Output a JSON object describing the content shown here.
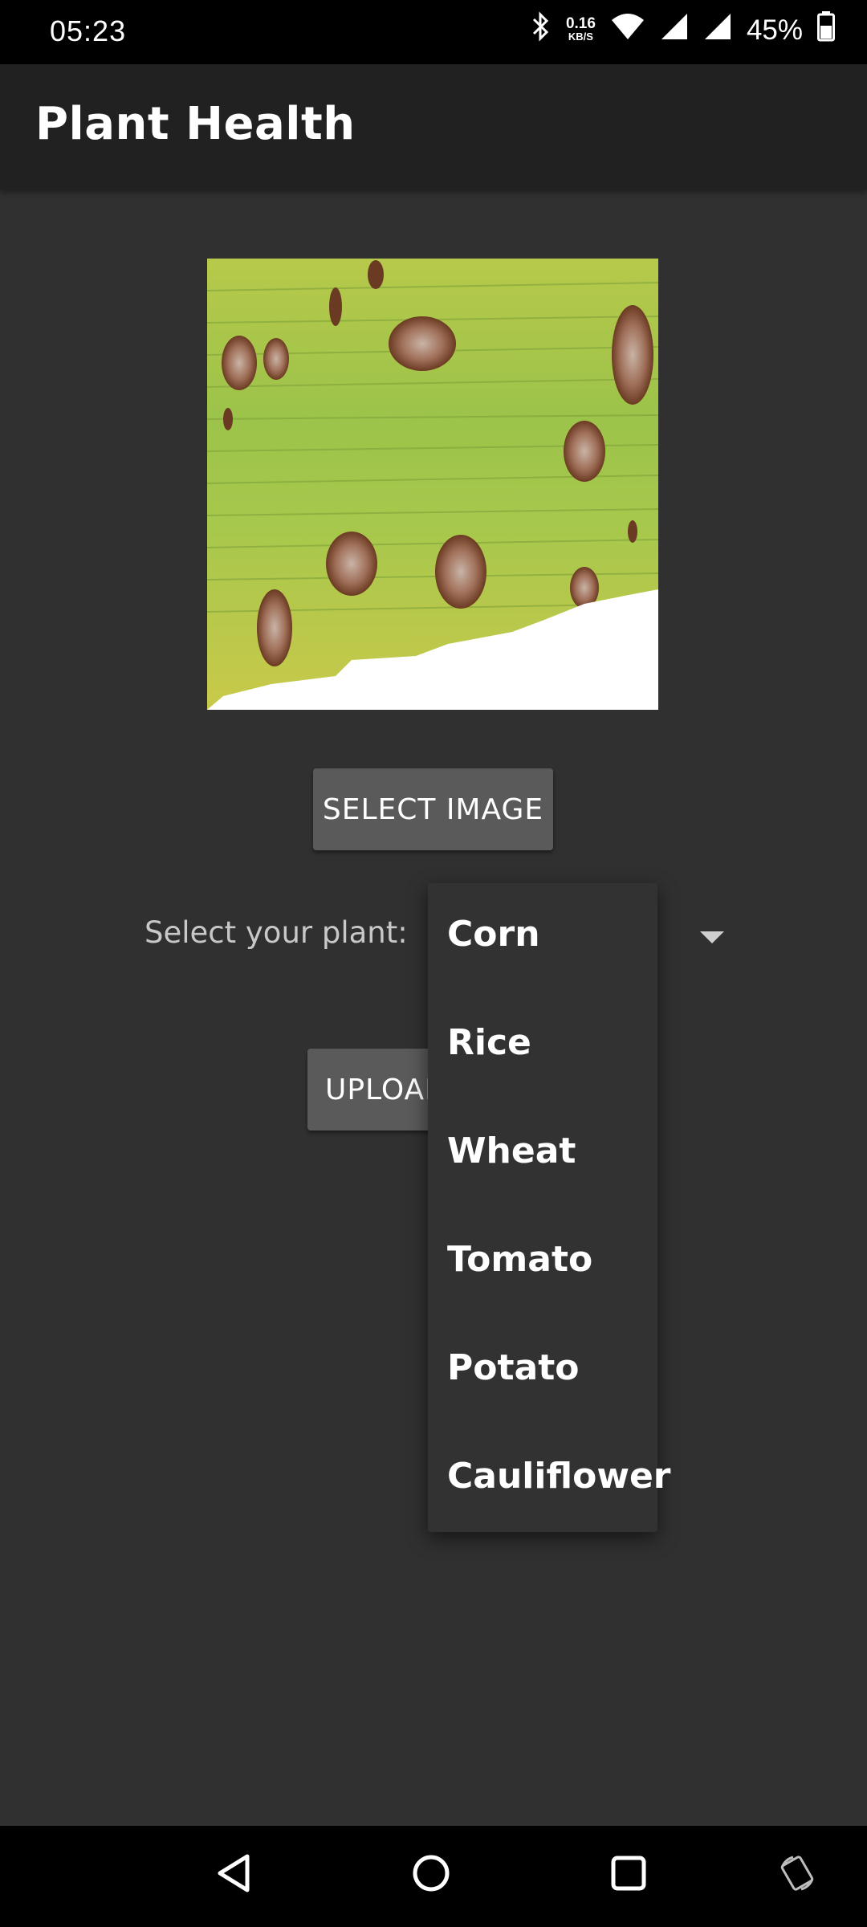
{
  "status_bar": {
    "time": "05:23",
    "net_speed_value": "0.16",
    "net_speed_unit": "KB/S",
    "battery_percent": "45%",
    "icons": [
      "bluetooth-icon",
      "wifi-icon",
      "signal-icon",
      "signal-icon",
      "battery-icon"
    ]
  },
  "app_bar": {
    "title": "Plant Health"
  },
  "main": {
    "image_description_icon": "leaf-image",
    "select_image_label": "SELECT IMAGE",
    "plant_label": "Select your plant:",
    "upload_label": "UPLOAD"
  },
  "dropdown": {
    "selected": "Corn",
    "options": [
      "Corn",
      "Rice",
      "Wheat",
      "Tomato",
      "Potato",
      "Cauliflower"
    ]
  },
  "nav_bar": {
    "icons": [
      "back-icon",
      "home-icon",
      "recents-icon",
      "rotate-icon"
    ]
  }
}
